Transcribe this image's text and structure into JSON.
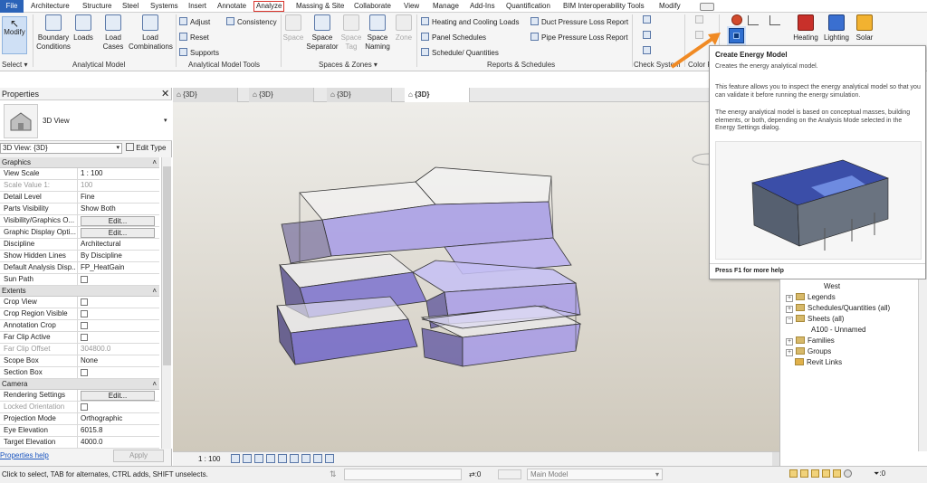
{
  "menu_tabs": [
    "File",
    "Architecture",
    "Structure",
    "Steel",
    "Systems",
    "Insert",
    "Annotate",
    "Analyze",
    "Massing & Site",
    "Collaborate",
    "View",
    "Manage",
    "Add-Ins",
    "Quantification",
    "BIM Interoperability Tools",
    "Modify"
  ],
  "ribbon": {
    "select": {
      "modify": "Modify",
      "panel": "Select"
    },
    "analytical_model": {
      "boundary": "Boundary Conditions",
      "loads": "Loads",
      "load_cases": "Load Cases",
      "load_combinations": "Load Combinations",
      "panel": "Analytical Model"
    },
    "analytical_tools": {
      "adjust": "Adjust",
      "reset": "Reset",
      "supports": "Supports",
      "consistency": "Consistency",
      "panel": "Analytical Model Tools"
    },
    "spaces": {
      "space": "Space",
      "separator": "Space Separator",
      "tag": "Space Tag",
      "naming": "Space Naming",
      "zone": "Zone",
      "panel": "Spaces & Zones"
    },
    "reports": {
      "heating": "Heating and Cooling Loads",
      "panel_schedules": "Panel Schedules",
      "schedule_quantities": "Schedule/ Quantities",
      "duct_pressure": "Duct Pressure Loss Report",
      "pipe_pressure": "Pipe Pressure Loss Report",
      "panel": "Reports & Schedules"
    },
    "check_systems": "Check System",
    "color_fill": "Color F",
    "energy": {
      "heating": "Heating",
      "lighting": "Lighting",
      "solar": "Solar"
    }
  },
  "tooltip": {
    "title": "Create Energy Model",
    "line1": "Creates the energy analytical model.",
    "line2": "This feature allows you to inspect the energy analytical model so that you can validate it before running the energy simulation.",
    "line3": "The energy analytical model is based on conceptual masses, building elements, or both, depending on the Analysis Mode selected in the Energy Settings dialog.",
    "footer": "Press F1 for more help"
  },
  "properties": {
    "title": "Properties",
    "type_name": "3D View",
    "selector": "3D View: {3D}",
    "edit_type": "Edit Type",
    "groups": [
      {
        "name": "Graphics",
        "rows": [
          {
            "k": "View Scale",
            "v": "1 : 100"
          },
          {
            "k": "Scale Value    1:",
            "v": "100",
            "grey": true
          },
          {
            "k": "Detail Level",
            "v": "Fine"
          },
          {
            "k": "Parts Visibility",
            "v": "Show Both"
          },
          {
            "k": "Visibility/Graphics O...",
            "v": "Edit...",
            "btn": true
          },
          {
            "k": "Graphic Display Opti...",
            "v": "Edit...",
            "btn": true
          },
          {
            "k": "Discipline",
            "v": "Architectural"
          },
          {
            "k": "Show Hidden Lines",
            "v": "By Discipline"
          },
          {
            "k": "Default Analysis Disp...",
            "v": "FP_HeatGain"
          },
          {
            "k": "Sun Path",
            "v": "",
            "chk": true
          }
        ]
      },
      {
        "name": "Extents",
        "rows": [
          {
            "k": "Crop View",
            "v": "",
            "chk": true
          },
          {
            "k": "Crop Region Visible",
            "v": "",
            "chk": true
          },
          {
            "k": "Annotation Crop",
            "v": "",
            "chk": true
          },
          {
            "k": "Far Clip Active",
            "v": "",
            "chk": true
          },
          {
            "k": "Far Clip Offset",
            "v": "304800.0",
            "grey": true
          },
          {
            "k": "Scope Box",
            "v": "None"
          },
          {
            "k": "Section Box",
            "v": "",
            "chk": true
          }
        ]
      },
      {
        "name": "Camera",
        "rows": [
          {
            "k": "Rendering Settings",
            "v": "Edit...",
            "btn": true
          },
          {
            "k": "Locked Orientation",
            "v": "",
            "chk": true,
            "grey": true
          },
          {
            "k": "Projection Mode",
            "v": "Orthographic"
          },
          {
            "k": "Eye Elevation",
            "v": "6015.8"
          },
          {
            "k": "Target Elevation",
            "v": "4000.0"
          }
        ]
      }
    ],
    "help": "Properties help",
    "apply": "Apply"
  },
  "view_tabs": [
    "{3D}",
    "{3D}",
    "{3D}",
    "{3D}"
  ],
  "view_scale": "1 : 100",
  "browser": {
    "west": "West",
    "legends": "Legends",
    "schedules": "Schedules/Quantities (all)",
    "sheets": "Sheets (all)",
    "sheet1": "A100 - Unnamed",
    "families": "Families",
    "groups": "Groups",
    "links": "Revit Links"
  },
  "status": {
    "text": "Click to select, TAB for alternates, CTRL adds, SHIFT unselects.",
    "model": "Main Model",
    "count": ":0",
    "filter": ":0"
  },
  "colors": {
    "accent": "#2b63b8",
    "mass_fill": "#7a6fd0",
    "arrow": "#f08a24"
  }
}
